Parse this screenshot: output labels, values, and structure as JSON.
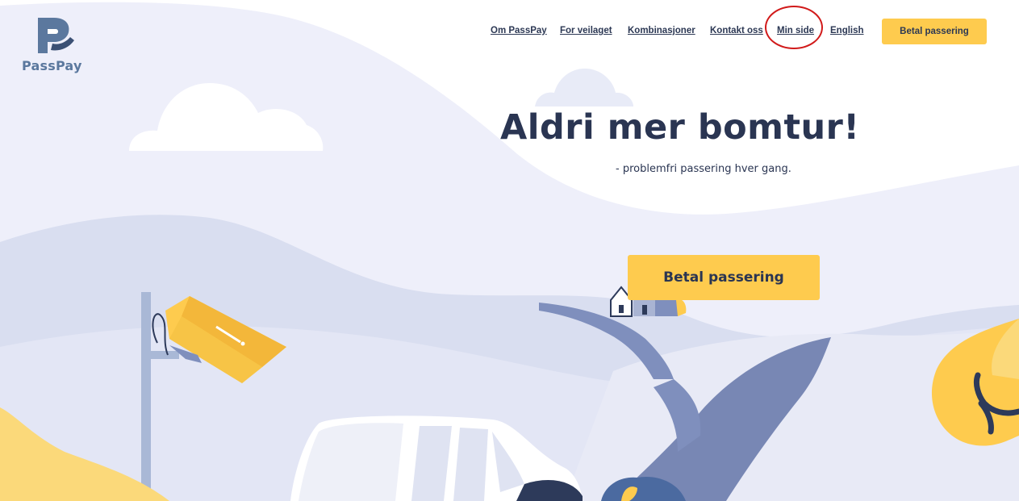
{
  "brand": {
    "name": "PassPay",
    "colors": {
      "accent": "#fecb4e",
      "text": "#2a3552",
      "brand": "#5b789e",
      "highlight": "#d11a1a"
    }
  },
  "nav": {
    "items": [
      {
        "label": "Om PassPay"
      },
      {
        "label": "For veilaget"
      },
      {
        "label": "Kombinasjoner"
      },
      {
        "label": "Kontakt oss"
      },
      {
        "label": "Min side"
      },
      {
        "label": "English"
      }
    ],
    "cta_label": "Betal passering"
  },
  "hero": {
    "title": "Aldri mer bomtur!",
    "subtitle": "- problemfri passering hver gang.",
    "cta_label": "Betal passering"
  },
  "icons": [
    "passpay-logo-icon",
    "cloud-icon",
    "camera-icon",
    "car-icon",
    "house-icon",
    "tree-icon"
  ]
}
